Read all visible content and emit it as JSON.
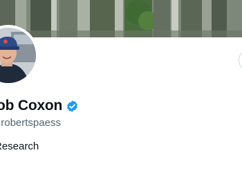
{
  "profile": {
    "display_name": "Rob Coxon",
    "handle": "@robertspaess",
    "bio": "Research",
    "verified_icon": "verified-badge-icon",
    "accent_color": "#1d9bf0"
  },
  "banner": {
    "description_icon": "header-photo"
  },
  "avatar": {
    "icon": "avatar"
  }
}
